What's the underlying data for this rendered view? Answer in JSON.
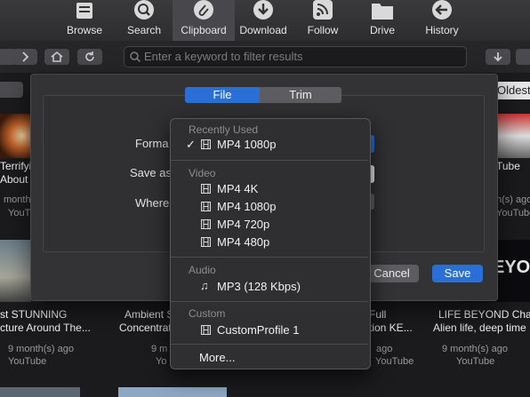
{
  "toolbar": {
    "items": [
      {
        "label": "Browse",
        "icon": "browse-icon"
      },
      {
        "label": "Search",
        "icon": "search-icon"
      },
      {
        "label": "Clipboard",
        "icon": "clipboard-icon"
      },
      {
        "label": "Download",
        "icon": "download-icon"
      },
      {
        "label": "Follow",
        "icon": "rss-icon"
      },
      {
        "label": "Drive",
        "icon": "folder-icon"
      },
      {
        "label": "History",
        "icon": "back-arrow-icon"
      }
    ],
    "active": "Clipboard"
  },
  "search": {
    "placeholder": "Enter a keyword to filter results"
  },
  "sort_label": "Oldest",
  "grid": {
    "row1": [
      {
        "title_a": "Terrifyi",
        "title_b": "About S",
        "ago": "month",
        "channel": "YouTube"
      },
      {
        "title_a": "Tube",
        "ago": "h(s) ago",
        "channel": "YouTube"
      }
    ],
    "row2": [
      {
        "title_a": "st STUNNING",
        "title_b": "cture Around The...",
        "ago": "9 month(s) ago",
        "channel": "YouTube"
      },
      {
        "title_a": "Ambient S",
        "title_b": "Concentrat",
        "ago": "9 m",
        "channel": "Yo"
      },
      {
        "title_a": "Full",
        "title_b": "tion KE...",
        "ago": "ago",
        "channel": "YouTube"
      },
      {
        "title_a": "LIFE BEYOND Chap",
        "title_b": "Alien life, deep time",
        "ago": "9 month(s) ago",
        "channel": "YouTube"
      }
    ],
    "thumb_text": "EYO"
  },
  "dialog": {
    "tabs": [
      "File",
      "Trim"
    ],
    "active_tab": "File",
    "labels": {
      "format": "Forma",
      "save_as": "Save as",
      "where": "Where"
    },
    "cancel": "Cancel",
    "save": "Save"
  },
  "menu": {
    "recent_header": "Recently Used",
    "recent": [
      {
        "label": "MP4 1080p",
        "checked": true
      }
    ],
    "video_header": "Video",
    "video": [
      "MP4 4K",
      "MP4 1080p",
      "MP4 720p",
      "MP4 480p"
    ],
    "audio_header": "Audio",
    "audio": [
      "MP3 (128 Kbps)"
    ],
    "custom_header": "Custom",
    "custom": [
      "CustomProfile 1"
    ],
    "more": "More..."
  },
  "colors": {
    "accent": "#2a6fd6",
    "menu_bg": "#2f2f32",
    "dialog_bg": "#333336"
  }
}
